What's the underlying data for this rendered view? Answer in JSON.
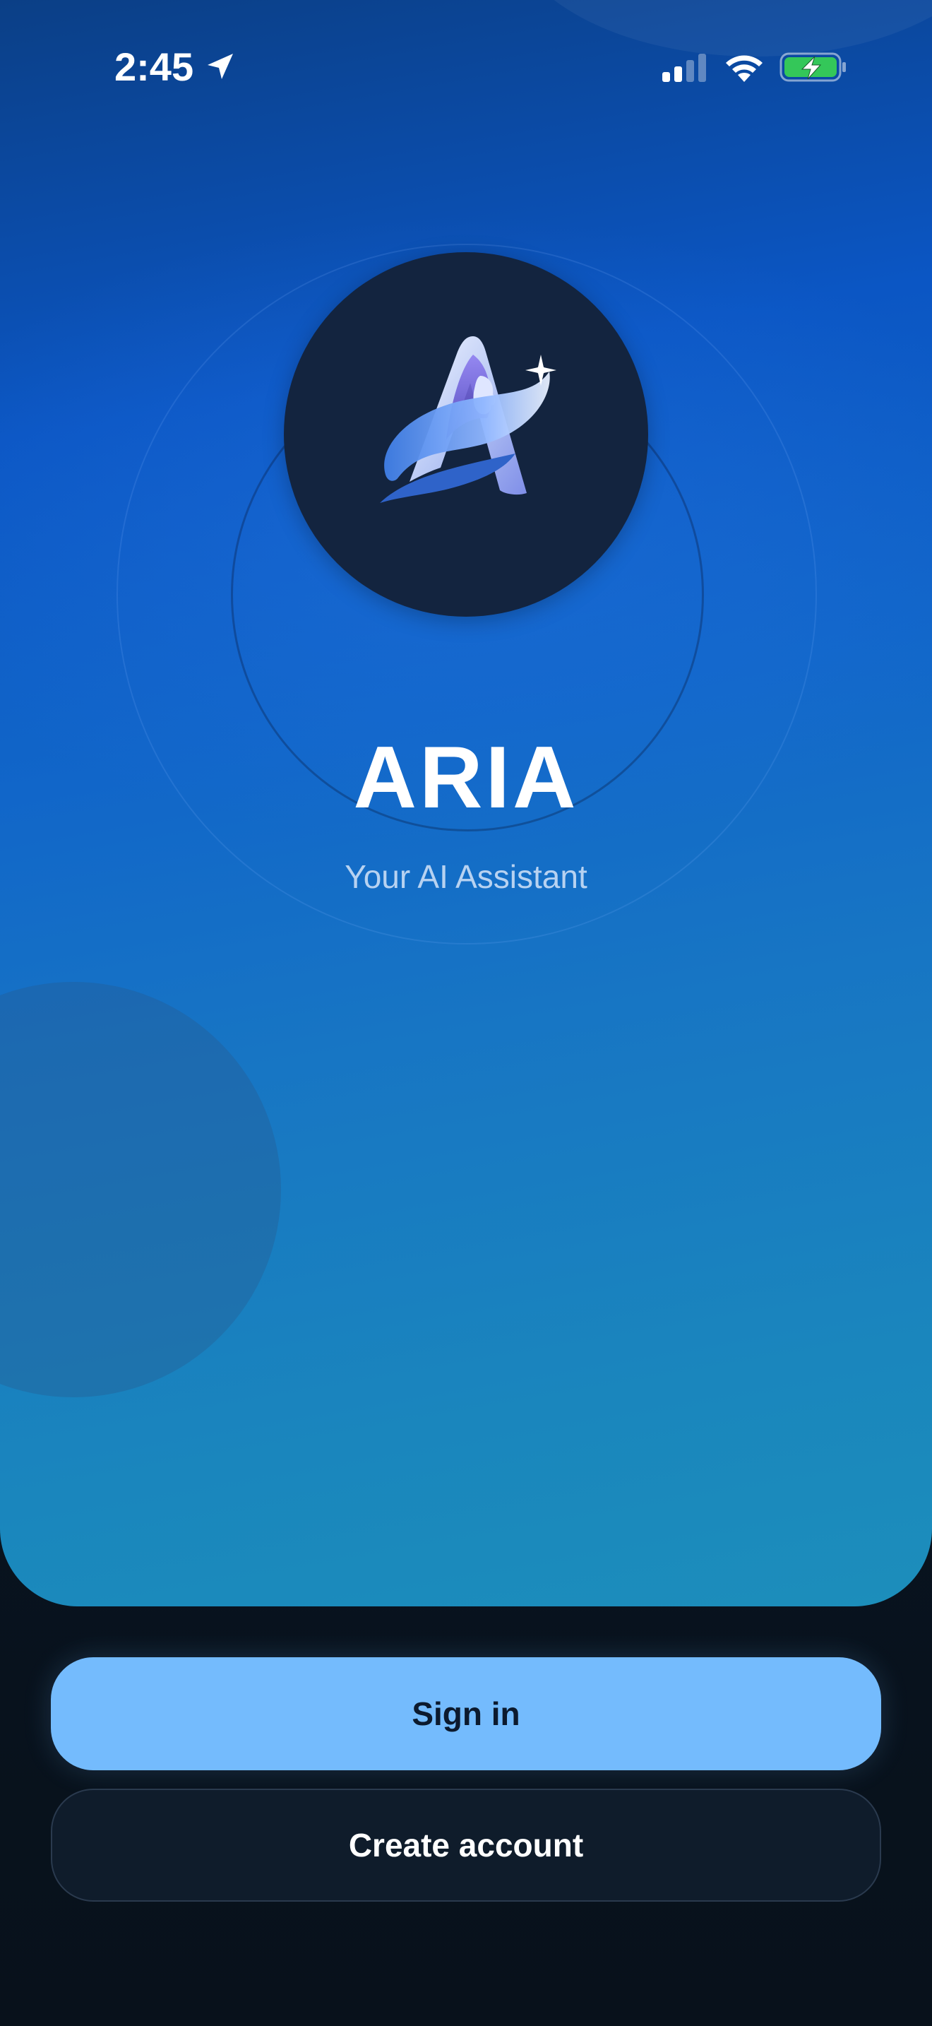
{
  "status_bar": {
    "time": "2:45",
    "location_icon": "location-arrow-icon",
    "signal_icon": "cellular-signal-icon",
    "wifi_icon": "wifi-icon",
    "battery_icon": "battery-charging-icon"
  },
  "app": {
    "logo_icon": "aria-logo-icon",
    "title": "ARIA",
    "subtitle": "Your AI Assistant"
  },
  "actions": {
    "sign_in_label": "Sign in",
    "create_account_label": "Create account"
  },
  "colors": {
    "primary_button": "#74bbfd",
    "hero_top": "#0b3f86",
    "hero_bottom": "#1c8ebb",
    "background": "#0a1522",
    "battery_fill": "#34c759"
  }
}
